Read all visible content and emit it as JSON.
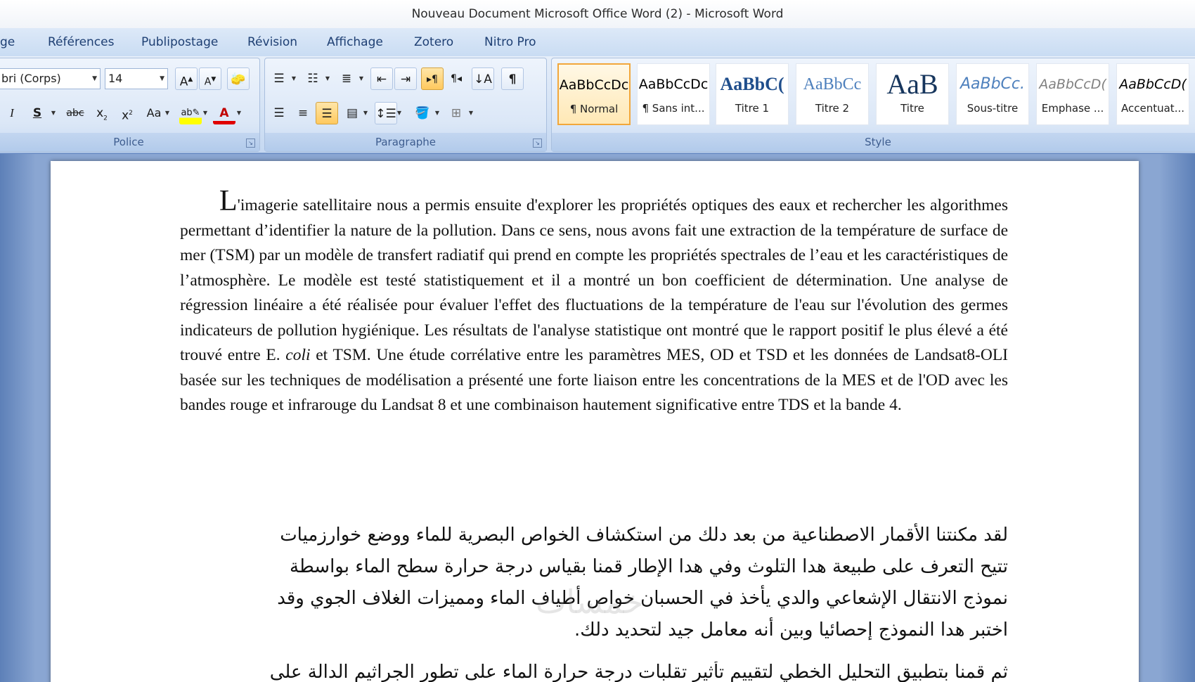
{
  "window": {
    "title": "Nouveau Document Microsoft Office Word (2) - Microsoft Word"
  },
  "tabs": [
    "ge",
    "Références",
    "Publipostage",
    "Révision",
    "Affichage",
    "Zotero",
    "Nitro Pro"
  ],
  "ribbon": {
    "police": {
      "label": "Police",
      "font_name": "bri (Corps)",
      "font_size": "14"
    },
    "paragraphe": {
      "label": "Paragraphe"
    },
    "style": {
      "label": "Style",
      "items": [
        {
          "sample": "AaBbCcDc",
          "name": "¶ Normal"
        },
        {
          "sample": "AaBbCcDc",
          "name": "¶ Sans int..."
        },
        {
          "sample": "AaBbC(",
          "name": "Titre 1"
        },
        {
          "sample": "AaBbCc",
          "name": "Titre 2"
        },
        {
          "sample": "AaB",
          "name": "Titre"
        },
        {
          "sample": "AaBbCc.",
          "name": "Sous-titre"
        },
        {
          "sample": "AaBbCcD(",
          "name": "Emphase ..."
        },
        {
          "sample": "AaBbCcD(",
          "name": "Accentuat..."
        }
      ]
    }
  },
  "document": {
    "fr_dropcap": "L",
    "fr_part1": "'imagerie satellitaire nous a permis ensuite d'explorer les propriétés optiques des eaux et rechercher les algorithmes permettant d’identifier la nature de la pollution. Dans ce sens,  nous avons fait une extraction de la température de surface de mer (TSM) par un modèle de transfert radiatif qui prend en compte les propriétés spectrales de l’eau et les caractéristiques de l’atmosphère. Le modèle est testé statistiquement et il a montré un bon coefficient de détermination. Une analyse de régression linéaire a été réalisée pour évaluer l'effet des fluctuations de la température de l'eau sur l'évolution des germes indicateurs de pollution hygiénique. Les résultats de l'analyse statistique ont montré que le rapport positif le plus élevé a été trouvé entre E. ",
    "fr_italic": "coli",
    "fr_part2": " et TSM.  Une étude corrélative entre les paramètres MES, OD et TSD et les données de Landsat8-OLI basée sur les techniques de modélisation a présenté une forte liaison entre les concentrations de la MES et de l'OD avec les bandes rouge et infrarouge du Landsat 8 et une combinaison hautement significative entre TDS et la bande 4.",
    "ar_line1": "لقد مكنتنا الأقمار الاصطناعية من بعد دلك من استكشاف الخواص البصرية للماء ووضع خوارزميات",
    "ar_line2": "تتيح التعرف على طبيعة هدا التلوث وفي هدا الإطار قمنا بقياس درجة حرارة سطح الماء بواسطة",
    "ar_line3": "نموذج الانتقال الإشعاعي والدي يأخذ في الحسبان خواص أطياف الماء ومميزات الغلاف الجوي وقد",
    "ar_line4": "اختبر هدا النموذج إحصائيا وبين أنه معامل جيد لتحديد دلك.",
    "ar_line5": "ثم قمنا بتطبيق التحليل الخطي لتقييم تأثير تقلبات درجة حرارة الماء على تطور الجراثيم الدالة على",
    "watermark": "خمسات"
  }
}
